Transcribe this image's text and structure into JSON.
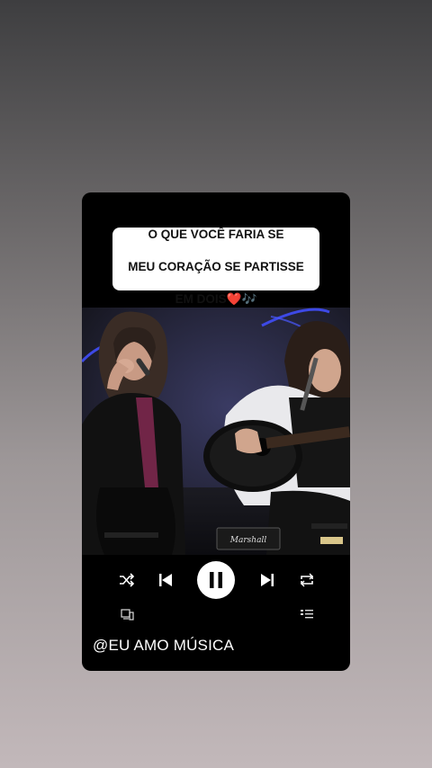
{
  "caption": {
    "line1": "O QUE VOCÊ FARIA SE",
    "line2": "MEU CORAÇÃO SE PARTISSE",
    "line3": "EM DOIS",
    "emoji_heart": "❤️",
    "emoji_notes": "🎶"
  },
  "video": {
    "amp_brand": "Marshall"
  },
  "player": {
    "state": "playing",
    "buttons": [
      "shuffle-icon",
      "previous-icon",
      "pause-icon",
      "next-icon",
      "repeat-icon",
      "devices-icon",
      "queue-icon"
    ],
    "accent_color": "#ffffff"
  },
  "handle": "@EU AMO MÚSICA"
}
